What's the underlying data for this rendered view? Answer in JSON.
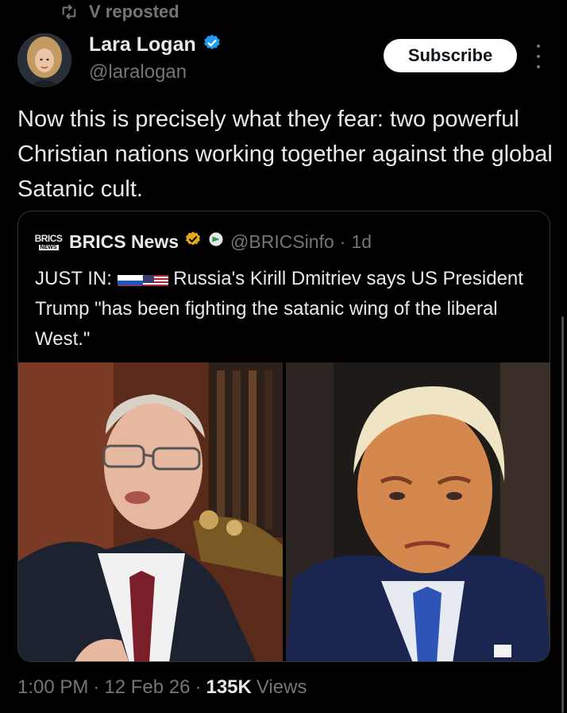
{
  "repost": {
    "icon": "repost-icon",
    "label": "V reposted"
  },
  "author": {
    "name": "Lara Logan",
    "handle": "@laralogan",
    "verified": true,
    "verified_color": "#1d9bf0"
  },
  "subscribe_label": "Subscribe",
  "tweet_text": "Now this is precisely what they fear: two powerful Christian nations working together against the global Satanic cult.",
  "quote": {
    "logo_text_top": "BRICS",
    "logo_text_bottom": "NEWS",
    "name": "BRICS News",
    "verified_color": "#e6a817",
    "handle": "@BRICSinfo",
    "separator": "·",
    "time": "1d",
    "text_prefix": "JUST IN:",
    "text_body": "Russia's Kirill Dmitriev says US President Trump \"has been fighting the satanic wing of the liberal West.\"",
    "flags": [
      "russia-flag-icon",
      "usa-flag-icon"
    ]
  },
  "meta": {
    "time": "1:00 PM",
    "sep1": "·",
    "date": "12 Feb 26",
    "sep2": "·",
    "views_count": "135K",
    "views_label": "Views"
  },
  "colors": {
    "background": "#000000",
    "text": "#e7e9ea",
    "muted": "#71767b",
    "border": "#2f3336"
  }
}
